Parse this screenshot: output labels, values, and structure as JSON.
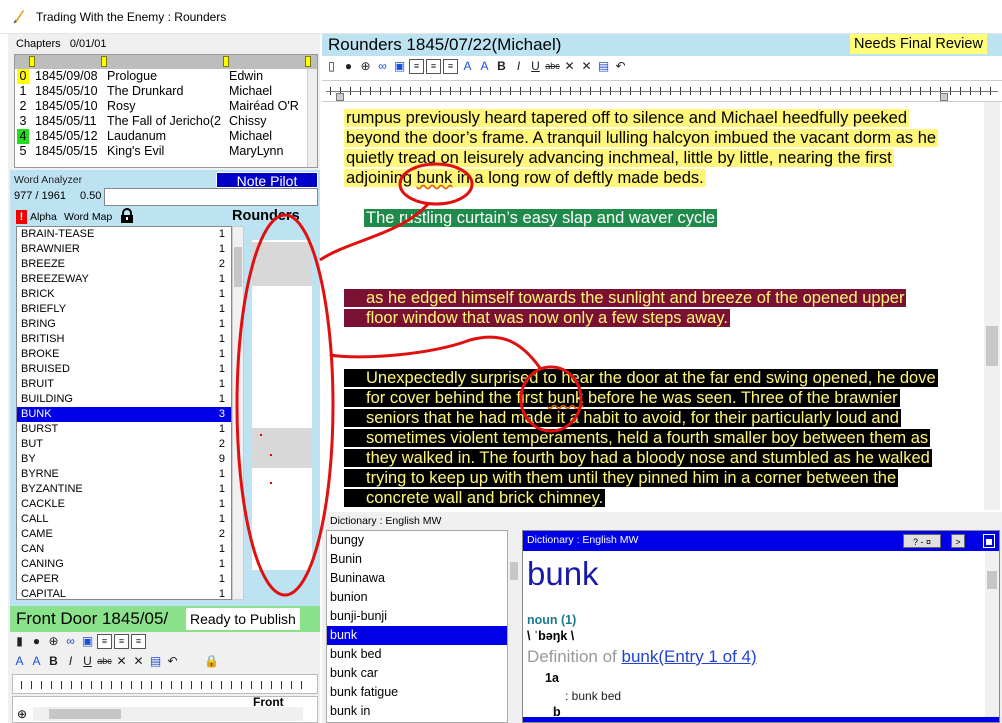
{
  "window": {
    "title": "Trading With the Enemy : Rounders"
  },
  "chapters": {
    "label": "Chapters",
    "count": "0/01/01",
    "rows": [
      {
        "num": "0",
        "date": "1845/09/08",
        "title": "Prologue",
        "pov": "Edwin",
        "num_bg": "#ffff00"
      },
      {
        "num": "1",
        "date": "1845/05/10",
        "title": "The Drunkard",
        "pov": "Michael",
        "num_bg": ""
      },
      {
        "num": "2",
        "date": "1845/05/10",
        "title": "Rosy",
        "pov": "Mairéad O'R",
        "num_bg": ""
      },
      {
        "num": "3",
        "date": "1845/05/11",
        "title": "The Fall of Jericho(2",
        "pov": "Chissy",
        "num_bg": ""
      },
      {
        "num": "4",
        "date": "1845/05/12",
        "title": "Laudanum",
        "pov": "Michael",
        "num_bg": "#22dd22"
      },
      {
        "num": "5",
        "date": "1845/05/15",
        "title": "King's Evil",
        "pov": "MaryLynn",
        "num_bg": ""
      }
    ]
  },
  "word_analyzer": {
    "label": "Word Analyzer",
    "note_pilot": "Note Pilot",
    "counts": "977 / 1961",
    "ratio": "0.50",
    "alert": "!",
    "tab_alpha": "Alpha",
    "tab_wordmap": "Word Map",
    "column_title": "Rounders",
    "words": [
      {
        "word": "BRAIN-TEASE",
        "count": "1"
      },
      {
        "word": "BRAWNIER",
        "count": "1"
      },
      {
        "word": "BREEZE",
        "count": "2"
      },
      {
        "word": "BREEZEWAY",
        "count": "1"
      },
      {
        "word": "BRICK",
        "count": "1"
      },
      {
        "word": "BRIEFLY",
        "count": "1"
      },
      {
        "word": "BRING",
        "count": "1"
      },
      {
        "word": "BRITISH",
        "count": "1"
      },
      {
        "word": "BROKE",
        "count": "1"
      },
      {
        "word": "BRUISED",
        "count": "1"
      },
      {
        "word": "BRUIT",
        "count": "1"
      },
      {
        "word": "BUILDING",
        "count": "1"
      },
      {
        "word": "BUNK",
        "count": "3"
      },
      {
        "word": "BURST",
        "count": "1"
      },
      {
        "word": "BUT",
        "count": "2"
      },
      {
        "word": "BY",
        "count": "9"
      },
      {
        "word": "BYRNE",
        "count": "1"
      },
      {
        "word": "BYZANTINE",
        "count": "1"
      },
      {
        "word": "CACKLE",
        "count": "1"
      },
      {
        "word": "CALL",
        "count": "1"
      },
      {
        "word": "CAME",
        "count": "2"
      },
      {
        "word": "CAN",
        "count": "1"
      },
      {
        "word": "CANING",
        "count": "1"
      },
      {
        "word": "CAPER",
        "count": "1"
      },
      {
        "word": "CAPITAL",
        "count": "1"
      }
    ],
    "selected_word": "BUNK"
  },
  "front_door": {
    "title": "Front Door 1845/05/",
    "status": "Ready to Publish",
    "crop_label": "Front"
  },
  "editor": {
    "title": "Rounders 1845/07/22(Michael)",
    "status": "Needs Final Review",
    "para1_before": "rumpus previously heard tapered off to silence and Michael heedfully peeked beyond the door’s frame.  A tranquil lulling halcyon imbued the vacant dorm as he quietly tread on leisurely advancing inchmeal, little by little, nearing the first adjoining ",
    "para1_word": "bunk",
    "para1_after": " in a long row of deftly made beds.",
    "para2": "The rustling curtain’s easy slap and waver cycle",
    "para3": "as he edged himself towards the sunlight and breeze of the opened upper floor window that was now only a few steps away.",
    "para4_before": "Unexpectedly surprised to hear the door at the far end swing opened, he dove for cover behind the first ",
    "para4_word": "bunk",
    "para4_after": " before he was seen.  Three of the brawnier seniors that he had made it a habit to avoid, for their particularly loud and sometimes violent temperaments, held a fourth smaller boy between them as they walked in.  The fourth boy had a bloody nose and stumbled as he walked trying to keep up with them until they pinned him in a corner between the concrete wall and brick chimney."
  },
  "dictionary": {
    "list_label": "Dictionary : English MW",
    "items": [
      "bungy",
      "Bunin",
      "Buninawa",
      "bunion",
      "bunji-bunji",
      "bunk",
      "bunk bed",
      "bunk car",
      "bunk fatigue",
      "bunk in"
    ],
    "selected": "bunk",
    "panel_title": "Dictionary : English MW",
    "btn_help": "? - ¤",
    "btn_next": ">",
    "entry_word": "bunk",
    "pos": "noun (1)",
    "pronunciation": "\\ ˈbəŋk \\",
    "def_prefix": "Definition of ",
    "def_word": "bunk",
    "def_entry": "(Entry 1 of 4)",
    "sense_1a": "1a",
    "sense_1a_text": ": bunk bed",
    "sense_b": "b"
  },
  "colors": {
    "highlight_yellow": "#fff67a",
    "highlight_green": "#1f8a4a",
    "highlight_maroon": "#7a1133",
    "selection_blue": "#0000e8",
    "header_cyan": "#bde3f2",
    "annotation_red": "#e01010"
  },
  "icons": [
    "pen-icon",
    "note-icon",
    "target-icon",
    "link-icon",
    "save-icon",
    "align-left-icon",
    "align-center-icon",
    "align-right-icon",
    "font-grow-icon",
    "font-shrink-icon",
    "bold-icon",
    "italic-icon",
    "underline-icon",
    "strikethrough-icon",
    "subscript-icon",
    "superscript-icon",
    "image-icon",
    "undo-icon",
    "lock-icon"
  ]
}
